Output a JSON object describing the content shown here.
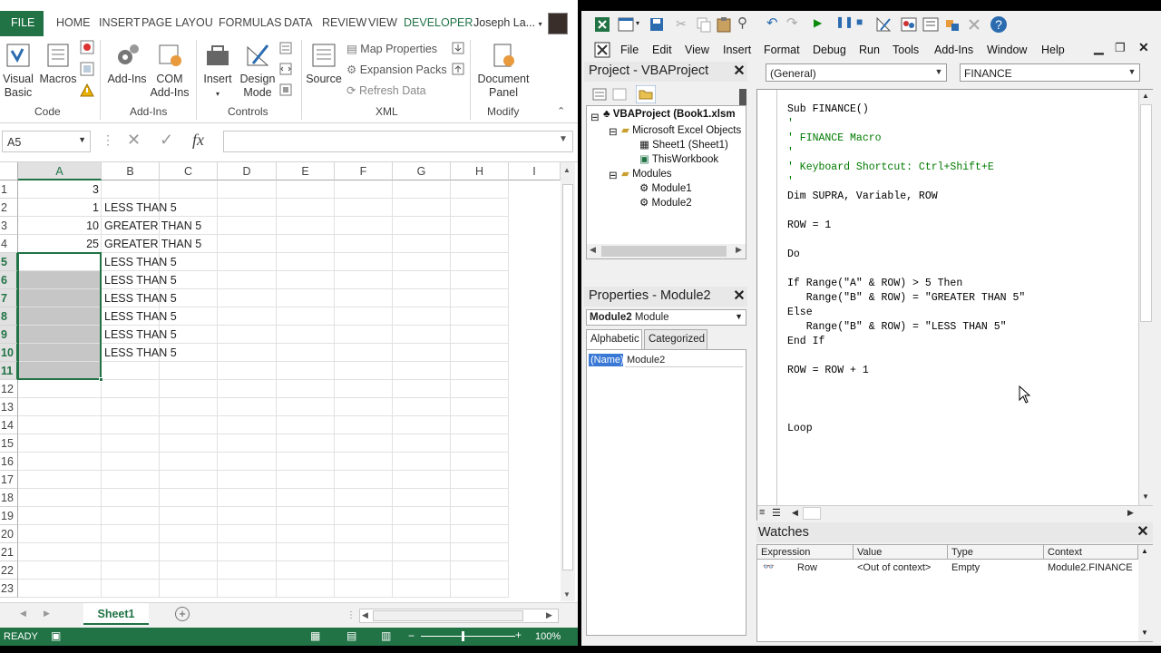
{
  "excel": {
    "tabs": [
      "FILE",
      "HOME",
      "INSERT",
      "PAGE LAYOU",
      "FORMULAS",
      "DATA",
      "REVIEW",
      "VIEW",
      "DEVELOPER"
    ],
    "user": "Joseph La...",
    "ribbon": {
      "visual_basic": "Visual\nBasic",
      "macros": "Macros",
      "addins": "Add-Ins",
      "com_addins": "COM\nAdd-Ins",
      "insert": "Insert",
      "design_mode": "Design\nMode",
      "source": "Source",
      "map_properties": "Map Properties",
      "expansion_packs": "Expansion Packs",
      "refresh_data": "Refresh Data",
      "document_panel": "Document\nPanel",
      "groups": {
        "code": "Code",
        "addins": "Add-Ins",
        "controls": "Controls",
        "xml": "XML",
        "modify": "Modify"
      }
    },
    "name_box": "A5",
    "fx_label": "fx",
    "columns": [
      "A",
      "B",
      "C",
      "D",
      "E",
      "F",
      "G",
      "H",
      "I"
    ],
    "rows": [
      "1",
      "2",
      "3",
      "4",
      "5",
      "6",
      "7",
      "8",
      "9",
      "10",
      "11",
      "12",
      "13",
      "14",
      "15",
      "16",
      "17",
      "18",
      "19",
      "20",
      "21",
      "22",
      "23"
    ],
    "cells": {
      "a": [
        "3",
        "1",
        "10",
        "25",
        "",
        "",
        "",
        "",
        "",
        "",
        ""
      ],
      "b": [
        "",
        "LESS THAN 5",
        "GREATER THAN 5",
        "GREATER THAN 5",
        "LESS THAN 5",
        "LESS THAN 5",
        "LESS THAN 5",
        "LESS THAN 5",
        "LESS THAN 5",
        "LESS THAN 5",
        ""
      ]
    },
    "sheet_tab": "Sheet1",
    "status": "READY",
    "zoom": "100%"
  },
  "vbe": {
    "menu": [
      "File",
      "Edit",
      "View",
      "Insert",
      "Format",
      "Debug",
      "Run",
      "Tools",
      "Add-Ins",
      "Window",
      "Help"
    ],
    "project_title": "Project - VBAProject",
    "tree": {
      "root": "VBAProject (Book1.xlsm",
      "objects_folder": "Microsoft Excel Objects",
      "sheet1": "Sheet1 (Sheet1)",
      "thisworkbook": "ThisWorkbook",
      "modules_folder": "Modules",
      "module1": "Module1",
      "module2": "Module2"
    },
    "properties_title": "Properties - Module2",
    "prop_combo_name": "Module2",
    "prop_combo_type": "Module",
    "prop_tabs": [
      "Alphabetic",
      "Categorized"
    ],
    "prop_name_key": "(Name)",
    "prop_name_val": "Module2",
    "object_combo": "(General)",
    "proc_combo": "FINANCE",
    "code": [
      "Sub FINANCE()",
      "'",
      "' FINANCE Macro",
      "'",
      "' Keyboard Shortcut: Ctrl+Shift+E",
      "'",
      "Dim SUPRA, Variable, ROW",
      "",
      "ROW = 1",
      "",
      "Do",
      "",
      "If Range(\"A\" & ROW) > 5 Then",
      "   Range(\"B\" & ROW) = \"GREATER THAN 5\"",
      "Else",
      "   Range(\"B\" & ROW) = \"LESS THAN 5\"",
      "End If",
      "",
      "ROW = ROW + 1",
      "",
      "",
      "",
      "Loop"
    ],
    "watches_title": "Watches",
    "watch_headers": [
      "Expression",
      "Value",
      "Type",
      "Context"
    ],
    "watch_row": [
      "Row",
      "<Out of context>",
      "Empty",
      "Module2.FINANCE"
    ]
  }
}
